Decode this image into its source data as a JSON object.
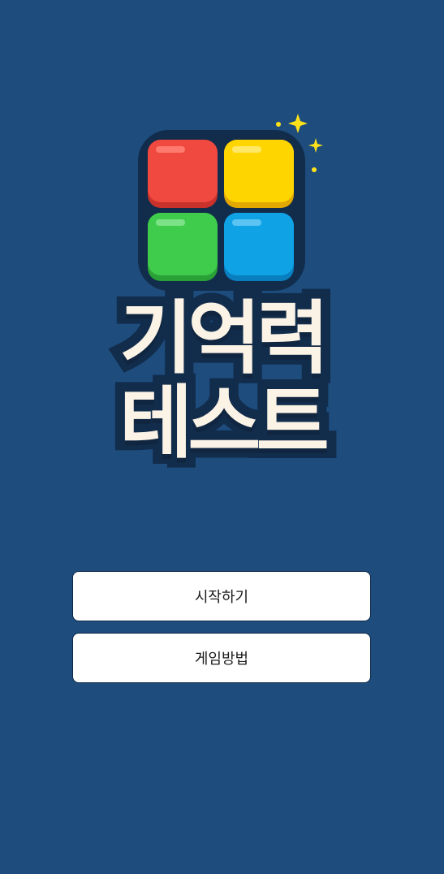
{
  "app": {
    "title_line1": "기억력",
    "title_line2": "테스트"
  },
  "logo": {
    "icon": "four-color-tiles-icon",
    "sparkle_icon": "sparkle-icon",
    "tile_colors": {
      "top_left": "#f0493f",
      "top_right": "#ffd500",
      "bottom_left": "#3fcc4c",
      "bottom_right": "#0fa3e6"
    },
    "sparkle_color": "#ffe11a"
  },
  "menu": {
    "start_label": "시작하기",
    "howto_label": "게임방법"
  },
  "colors": {
    "background": "#1d4c7d",
    "title_fill": "#fbf3e6",
    "title_outline": "#122c4b",
    "button_bg": "#ffffff",
    "button_border": "#0d2744"
  }
}
